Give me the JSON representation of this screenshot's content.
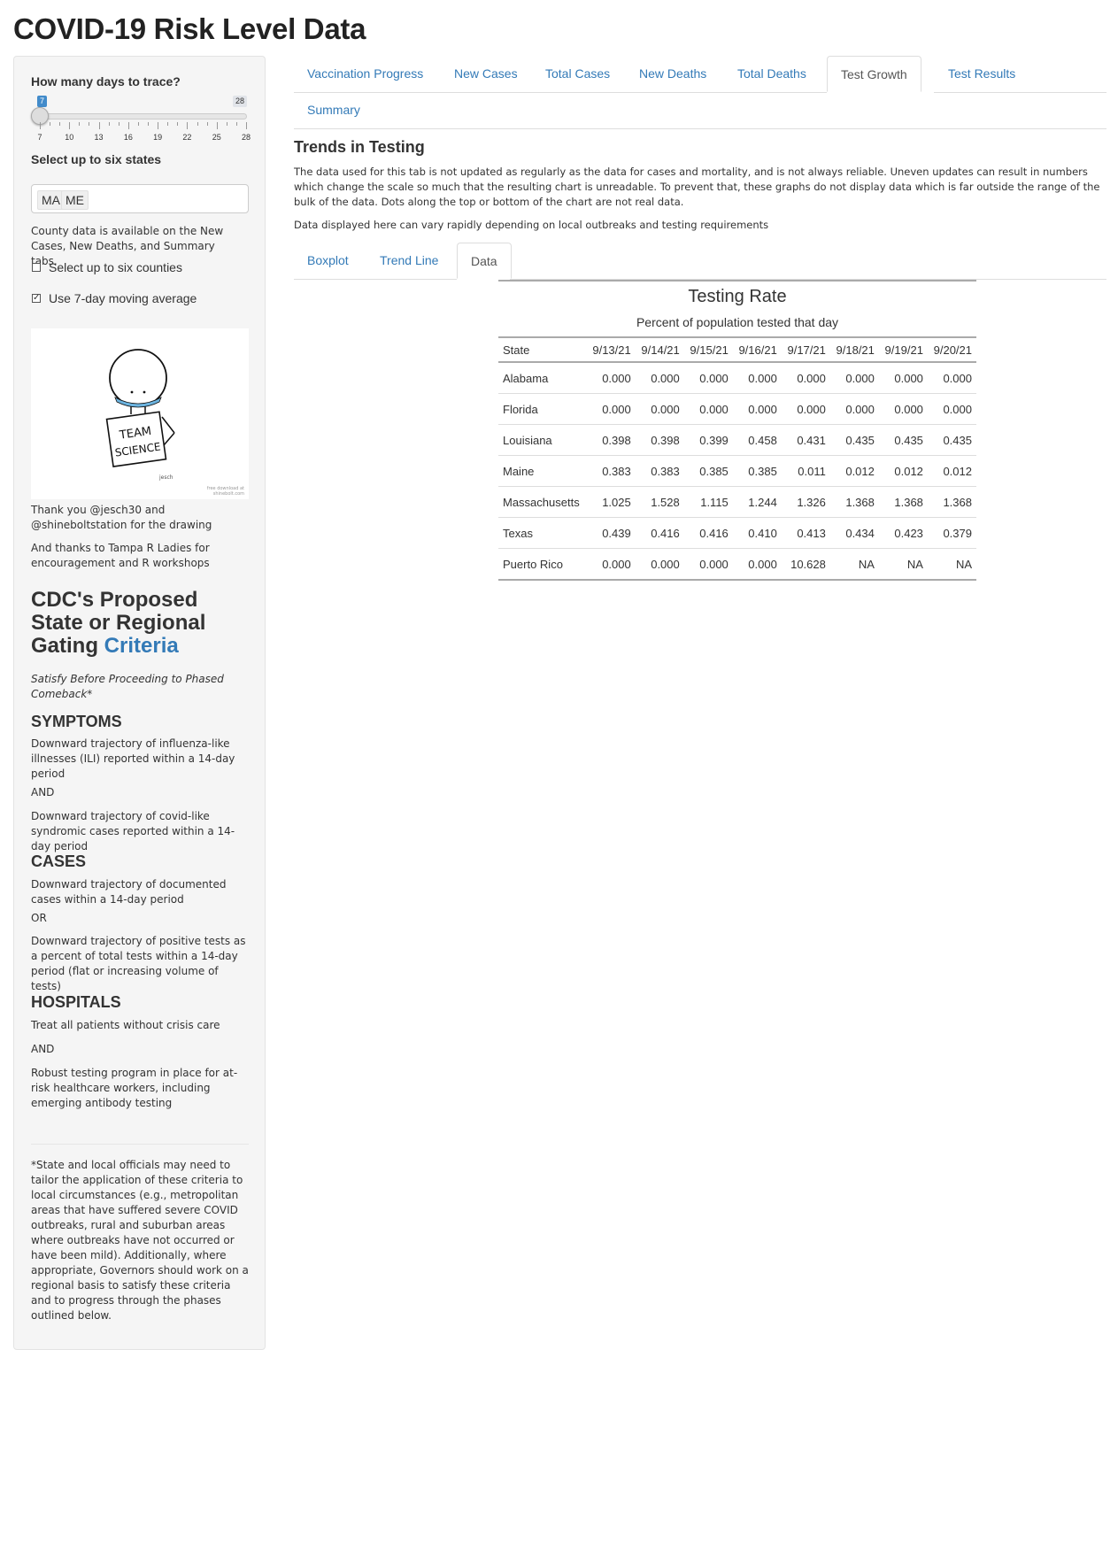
{
  "page": {
    "title": "COVID-19 Risk Level Data"
  },
  "sidebar": {
    "days_label": "How many days to trace?",
    "slider": {
      "min_label": "7",
      "max_label": "28",
      "value": 7,
      "min": 7,
      "max": 28,
      "tick_labels": [
        "7",
        "10",
        "13",
        "16",
        "19",
        "22",
        "25",
        "28"
      ]
    },
    "states_label": "Select up to six states",
    "selected_states": [
      "MA",
      "ME"
    ],
    "county_note": "County data is available on the New Cases, New Deaths, and Summary tabs.",
    "counties_checkbox": {
      "label": "Select up to six counties",
      "checked": false
    },
    "moving_avg_checkbox": {
      "label": "Use 7-day moving average",
      "checked": true
    },
    "drawing": {
      "sign_text_1": "TEAM",
      "sign_text_2": "SCIENCE",
      "credit_1": "free download at",
      "credit_2": "shinebolt.com",
      "signature": "jesch"
    },
    "thanks_1": "Thank you @jesch30 and @shineboltstation for the drawing",
    "thanks_2": "And thanks to Tampa R Ladies for encouragement and R workshops",
    "cdc_heading_prefix": "CDC's Proposed State or Regional Gating",
    "cdc_heading_link": "Criteria",
    "cdc_subtitle": "Satisfy Before Proceeding to Phased Comeback*",
    "symptoms_heading": "SYMPTOMS",
    "symptoms_1": "Downward trajectory of influenza-like illnesses (ILI) reported within a 14-day period",
    "and_1": "AND",
    "symptoms_2": "Downward trajectory of covid-like syndromic cases reported within a 14-day period",
    "cases_heading": "CASES",
    "cases_1": "Downward trajectory of documented cases within a 14-day period",
    "or_1": "OR",
    "cases_2": "Downward trajectory of positive tests as a percent of total tests within a 14-day period (flat or increasing volume of tests)",
    "hospitals_heading": "HOSPITALS",
    "hospitals_1": "Treat all patients without crisis care",
    "and_2": "AND",
    "hospitals_2": "Robust testing program in place for at-risk healthcare workers, including emerging antibody testing",
    "footnote": "*State and local officials may need to tailor the application of these criteria to local circumstances (e.g., metropolitan areas that have suffered severe COVID outbreaks, rural and suburban areas where outbreaks have not occurred or have been mild). Additionally, where appropriate, Governors should work on a regional basis to satisfy these criteria and to progress through the phases outlined below."
  },
  "main": {
    "tabs": [
      "Vaccination Progress",
      "New Cases",
      "Total Cases",
      "New Deaths",
      "Total Deaths",
      "Test Growth",
      "Test Results",
      "Summary"
    ],
    "active_tab": "Test Growth",
    "heading": "Trends in Testing",
    "para_1": "The data used for this tab is not updated as regularly as the data for cases and mortality, and is not always reliable. Uneven updates can result in numbers which change the scale so much that the resulting chart is unreadable. To prevent that, these graphs do not display data which is far outside the range of the bulk of the data. Dots along the top or bottom of the chart are not real data.",
    "para_2": "Data displayed here can vary rapidly depending on local outbreaks and testing requirements",
    "subtabs": [
      "Boxplot",
      "Trend Line",
      "Data"
    ],
    "active_subtab": "Data",
    "table": {
      "title": "Testing Rate",
      "subtitle": "Percent of population tested that day",
      "columns": [
        "State",
        "9/13/21",
        "9/14/21",
        "9/15/21",
        "9/16/21",
        "9/17/21",
        "9/18/21",
        "9/19/21",
        "9/20/21"
      ],
      "rows": [
        [
          "Alabama",
          "0.000",
          "0.000",
          "0.000",
          "0.000",
          "0.000",
          "0.000",
          "0.000",
          "0.000"
        ],
        [
          "Florida",
          "0.000",
          "0.000",
          "0.000",
          "0.000",
          "0.000",
          "0.000",
          "0.000",
          "0.000"
        ],
        [
          "Louisiana",
          "0.398",
          "0.398",
          "0.399",
          "0.458",
          "0.431",
          "0.435",
          "0.435",
          "0.435"
        ],
        [
          "Maine",
          "0.383",
          "0.383",
          "0.385",
          "0.385",
          "0.011",
          "0.012",
          "0.012",
          "0.012"
        ],
        [
          "Massachusetts",
          "1.025",
          "1.528",
          "1.115",
          "1.244",
          "1.326",
          "1.368",
          "1.368",
          "1.368"
        ],
        [
          "Texas",
          "0.439",
          "0.416",
          "0.416",
          "0.410",
          "0.413",
          "0.434",
          "0.423",
          "0.379"
        ],
        [
          "Puerto Rico",
          "0.000",
          "0.000",
          "0.000",
          "0.000",
          "10.628",
          "NA",
          "NA",
          "NA"
        ]
      ]
    }
  }
}
